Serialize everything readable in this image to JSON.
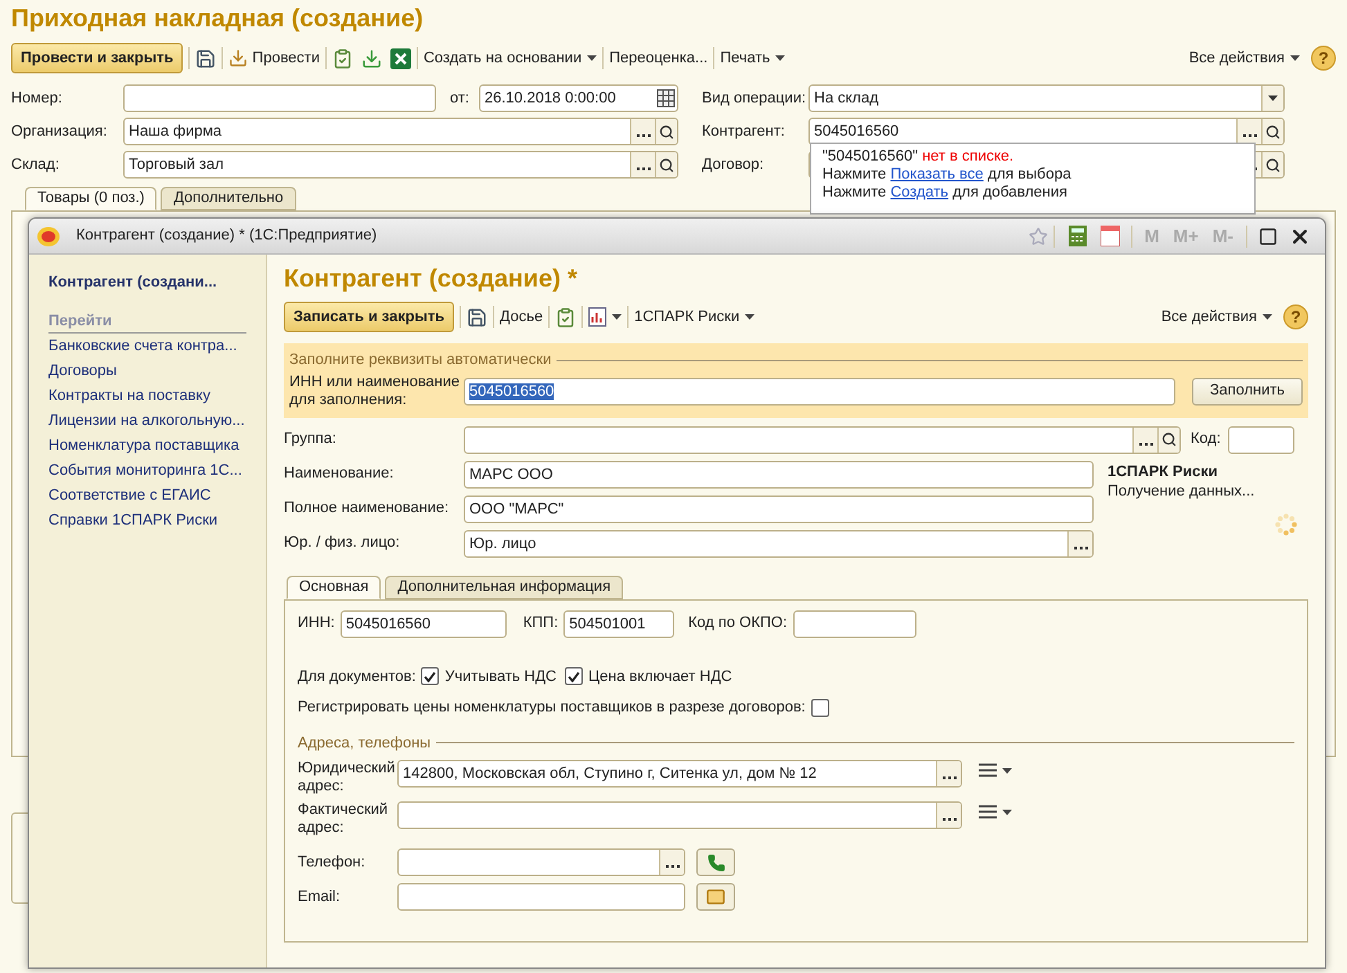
{
  "document": {
    "title": "Приходная накладная (создание)",
    "toolbar": {
      "primary": "Провести и закрыть",
      "post": "Провести",
      "create_based": "Создать на основании",
      "revalue": "Переоценка...",
      "print": "Печать",
      "all_actions": "Все действия",
      "help": "?"
    },
    "number": {
      "label": "Номер:"
    },
    "date": {
      "label": "от:",
      "value": "26.10.2018  0:00:00"
    },
    "organization": {
      "label": "Организация:",
      "value": "Наша фирма"
    },
    "warehouse": {
      "label": "Склад:",
      "value": "Торговый зал"
    },
    "operation": {
      "label": "Вид операции:",
      "value": "На склад"
    },
    "counterparty": {
      "label": "Контрагент:",
      "value": "5045016560"
    },
    "contract": {
      "label": "Договор:"
    },
    "tabs": [
      {
        "label": "Товары (0 поз.)",
        "selected": true
      },
      {
        "label": "Дополнительно",
        "selected": false
      }
    ]
  },
  "dropdown": {
    "query": "\"5045016560\"",
    "message": "нет в списке.",
    "lines": [
      {
        "before": "Нажмите",
        "link": "Показать все",
        "after": "для выбора"
      },
      {
        "before": "Нажмите",
        "link": "Создать",
        "after": "для добавления"
      }
    ]
  },
  "dialog": {
    "window_title": "Контрагент (создание) *  (1С:Предприятие)",
    "window_buttons": [
      "M",
      "M+",
      "M-"
    ],
    "sidebar": {
      "header": "Контрагент (создани...",
      "section": "Перейти",
      "items": [
        "Банковские счета контра...",
        "Договоры",
        "Контракты на поставку",
        "Лицензии на алкогольную...",
        "Номенклатура поставщика",
        "События мониторинга 1С...",
        "Соответствие с ЕГАИС",
        "Справки 1СПАРК Риски"
      ]
    },
    "title": "Контрагент (создание) *",
    "toolbar": {
      "primary": "Записать и закрыть",
      "dossier": "Досье",
      "spark": "1СПАРК Риски",
      "all_actions": "Все действия",
      "help": "?"
    },
    "autofill": {
      "heading": "Заполните реквизиты автоматически",
      "label": "ИНН или наименование для заполнения:",
      "value": "5045016560",
      "highlighted": true,
      "button": "Заполнить"
    },
    "group": {
      "label": "Группа:"
    },
    "code": {
      "label": "Код:"
    },
    "name": {
      "label": "Наименование:",
      "value": "МАРС ООО"
    },
    "full_name": {
      "label": "Полное наименование:",
      "value": "ООО \"МАРС\""
    },
    "legal_type": {
      "label": "Юр. / физ. лицо:",
      "value": "Юр. лицо"
    },
    "spark_panel": {
      "title": "1СПАРК Риски",
      "status": "Получение данных..."
    },
    "tabs": [
      {
        "label": "Основная",
        "selected": true
      },
      {
        "label": "Дополнительная информация",
        "selected": false
      }
    ],
    "inn": {
      "label": "ИНН:",
      "value": "5045016560"
    },
    "kpp": {
      "label": "КПП:",
      "value": "504501001"
    },
    "okpo": {
      "label": "Код по ОКПО:"
    },
    "documents_label": "Для документов:",
    "checkboxes": [
      {
        "label": "Учитывать НДС",
        "checked": true
      },
      {
        "label": "Цена включает НДС",
        "checked": true
      }
    ],
    "register_prices": {
      "label": "Регистрировать цены номенклатуры поставщиков в разрезе договоров:",
      "checked": false
    },
    "contacts": {
      "heading": "Адреса, телефоны",
      "legal_address": {
        "label": "Юридический адрес:",
        "value": "142800, Московская обл, Ступино г, Ситенка ул, дом № 12"
      },
      "actual_address": {
        "label": "Фактический адрес:"
      },
      "phone": {
        "label": "Телефон:"
      },
      "email": {
        "label": "Email:"
      }
    }
  }
}
